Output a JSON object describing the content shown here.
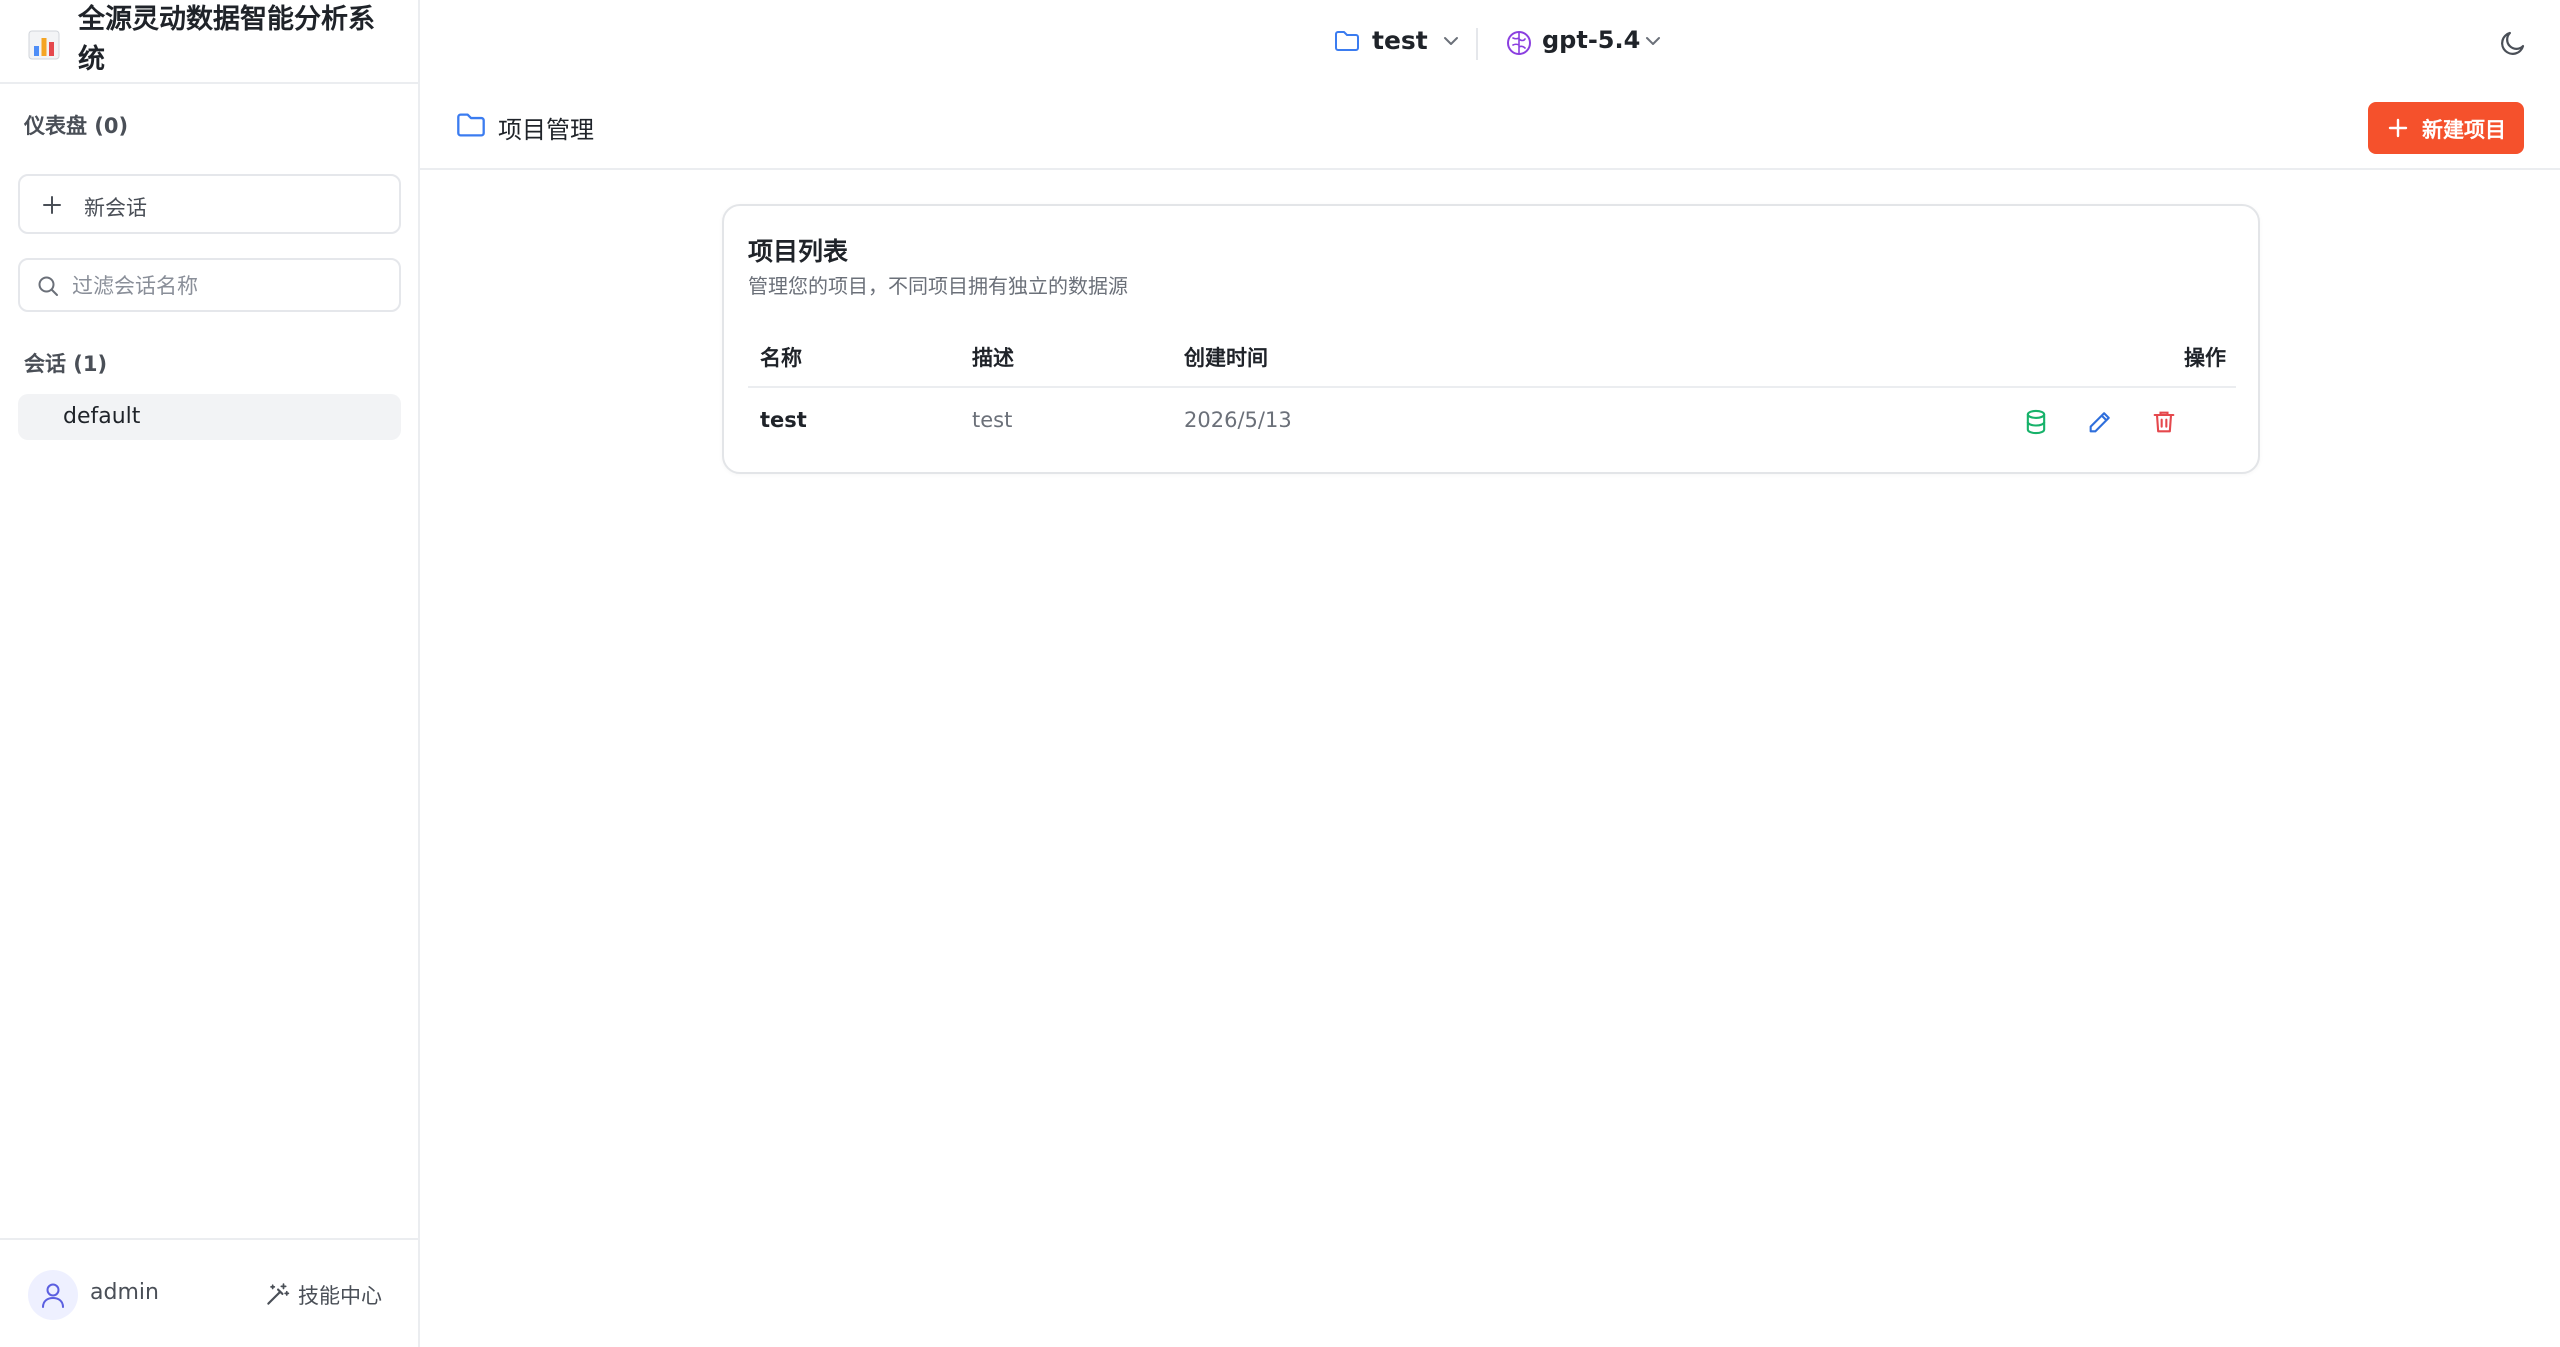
{
  "sidebar": {
    "brand_title": "全源灵动数据智能分析系统",
    "dashboard_label": "仪表盘 (0)",
    "new_chat_label": "新会话",
    "filter_placeholder": "过滤会话名称",
    "conversations_label": "会话 (1)",
    "conversations": [
      {
        "label": "default"
      }
    ],
    "footer": {
      "user_name": "admin",
      "skill_center_label": "技能中心"
    }
  },
  "topbar": {
    "project_name": "test",
    "model_name": "gpt-5.4"
  },
  "page": {
    "title": "项目管理",
    "new_project_label": "新建项目"
  },
  "card": {
    "title": "项目列表",
    "subtitle": "管理您的项目，不同项目拥有独立的数据源",
    "columns": [
      "名称",
      "描述",
      "创建时间",
      "操作"
    ],
    "rows": [
      {
        "name": "test",
        "description": "test",
        "created": "2026/5/13"
      }
    ]
  },
  "colors": {
    "accent": "#f5512c",
    "folder_blue": "#3b7cf0",
    "brain_purple": "#8b3fe0",
    "db_green": "#17b26a",
    "edit_blue": "#2f6fdc",
    "delete_red": "#e5484d"
  }
}
